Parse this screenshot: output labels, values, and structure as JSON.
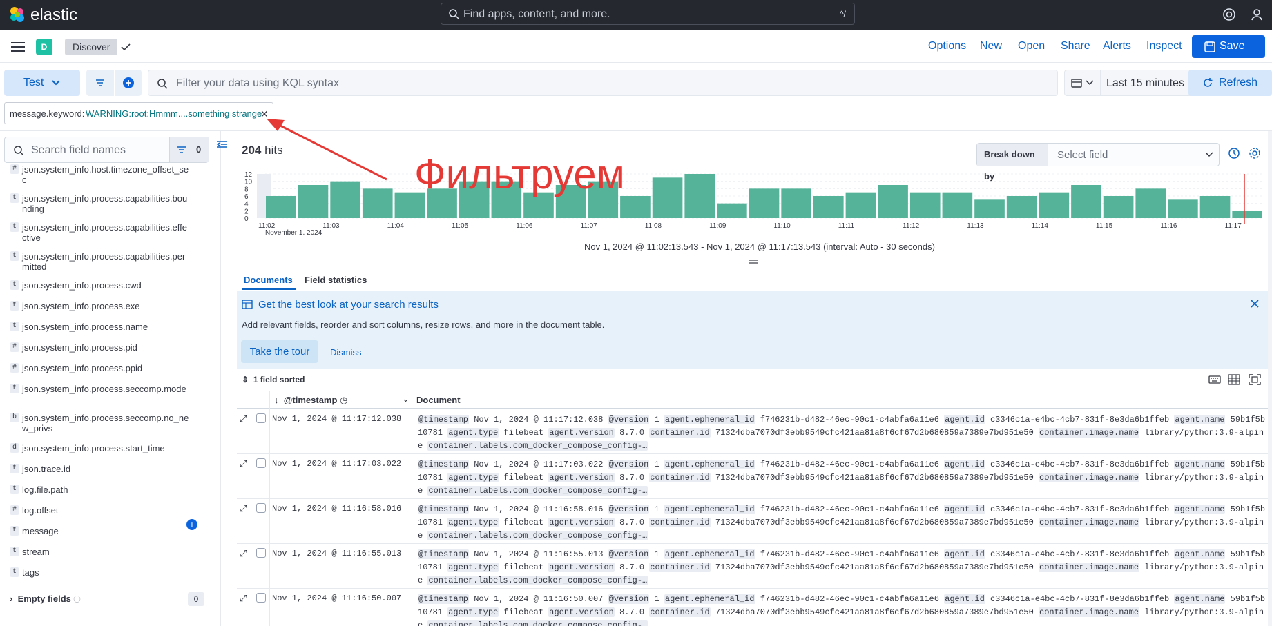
{
  "topbar": {
    "brand": "elastic",
    "search_placeholder": "Find apps, content, and more.",
    "shortcut": "^/"
  },
  "nav": {
    "space_initial": "D",
    "breadcrumb": "Discover",
    "links": [
      "Options",
      "New",
      "Open",
      "Share",
      "Alerts",
      "Inspect"
    ],
    "save_label": "Save"
  },
  "query": {
    "dataview": "Test",
    "kql_placeholder": "Filter your data using KQL syntax",
    "time_range": "Last 15 minutes",
    "refresh_label": "Refresh"
  },
  "filter_pill": {
    "key": "message.keyword:",
    "value": "WARNING:root:Hmmm....something strange"
  },
  "sidebar": {
    "search_placeholder": "Search field names",
    "filter_count": "0",
    "fields": [
      {
        "type": "#",
        "name": "json.system_info.host.timezone_offset_sec"
      },
      {
        "type": "t",
        "name": "json.system_info.process.capabilities.bounding"
      },
      {
        "type": "t",
        "name": "json.system_info.process.capabilities.effective"
      },
      {
        "type": "t",
        "name": "json.system_info.process.capabilities.permitted"
      },
      {
        "type": "t",
        "name": "json.system_info.process.cwd"
      },
      {
        "type": "t",
        "name": "json.system_info.process.exe"
      },
      {
        "type": "t",
        "name": "json.system_info.process.name"
      },
      {
        "type": "#",
        "name": "json.system_info.process.pid"
      },
      {
        "type": "#",
        "name": "json.system_info.process.ppid"
      },
      {
        "type": "t",
        "name": "json.system_info.process.seccomp.mode"
      },
      {
        "type": "b",
        "name": "json.system_info.process.seccomp.no_new_privs"
      },
      {
        "type": "d",
        "name": "json.system_info.process.start_time"
      },
      {
        "type": "t",
        "name": "json.trace.id"
      },
      {
        "type": "t",
        "name": "log.file.path"
      },
      {
        "type": "#",
        "name": "log.offset"
      },
      {
        "type": "t",
        "name": "message"
      },
      {
        "type": "t",
        "name": "stream"
      },
      {
        "type": "t",
        "name": "tags"
      }
    ],
    "empty_fields_label": "Empty fields",
    "empty_fields_count": "0"
  },
  "main": {
    "hits_count": "204",
    "hits_label": "hits",
    "breakdown_label": "Break down by",
    "breakdown_placeholder": "Select field",
    "interval_text": "Nov 1, 2024 @ 11:02:13.543 - Nov 1, 2024 @ 11:17:13.543 (interval: Auto - 30 seconds)",
    "tabs": [
      "Documents",
      "Field statistics"
    ],
    "callout_title": "Get the best look at your search results",
    "callout_text": "Add relevant fields, reorder and sort columns, resize rows, and more in the document table.",
    "tour_label": "Take the tour",
    "dismiss_label": "Dismiss",
    "sorted_label": "1 field sorted",
    "col_timestamp": "@timestamp",
    "col_document": "Document"
  },
  "chart_data": {
    "type": "bar",
    "y_ticks": [
      "12",
      "10",
      "8",
      "6",
      "4",
      "2",
      "0"
    ],
    "x_ticks": [
      "11:02",
      "11:03",
      "11:04",
      "11:05",
      "11:06",
      "11:07",
      "11:08",
      "11:09",
      "11:10",
      "11:11",
      "11:12",
      "11:13",
      "11:14",
      "11:15",
      "11:16",
      "11:17"
    ],
    "x_sublabel": "November 1, 2024",
    "values": [
      6,
      9,
      10,
      8,
      7,
      8,
      10,
      10,
      7,
      9,
      10,
      6,
      11,
      12,
      4,
      8,
      8,
      6,
      7,
      9,
      7,
      7,
      5,
      6,
      7,
      9,
      6,
      8,
      5,
      6,
      2
    ],
    "ylim": [
      0,
      12
    ],
    "bar_color": "#54b399"
  },
  "rows": [
    {
      "ts": "Nov 1, 2024 @ 11:17:12.038"
    },
    {
      "ts": "Nov 1, 2024 @ 11:17:03.022"
    },
    {
      "ts": "Nov 1, 2024 @ 11:16:58.016"
    },
    {
      "ts": "Nov 1, 2024 @ 11:16:55.013"
    },
    {
      "ts": "Nov 1, 2024 @ 11:16:50.007"
    }
  ],
  "doc": {
    "version": "1",
    "ephemeral_id": "f746231b-d482-46ec-90c1-c4abfa6a11e6",
    "agent_id": "c3346c1a-e4bc-4cb7-831f-8e3da6b1ffeb",
    "agent_name": "59b1f5b10781",
    "agent_type": "filebeat",
    "agent_version": "8.7.0",
    "container_id": "71324dba7070df3ebb9549cfc421aa81a8f6cf67d2b680859a7389e7bd951e50",
    "image_name": "library/python:3.9-alpine"
  },
  "annotation": {
    "text": "Фильтруем",
    "color": "#e53935"
  }
}
